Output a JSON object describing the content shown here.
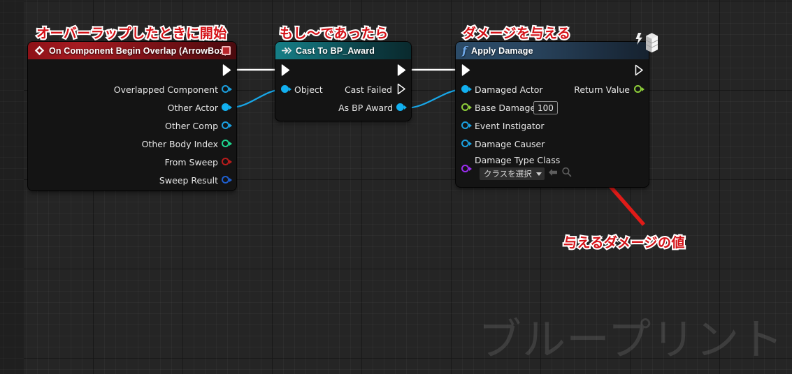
{
  "canvas": {
    "watermark": "ブループリント",
    "background_color": "#252525",
    "grid_minor_color": "#2d2d2d",
    "grid_major_color": "#111111"
  },
  "callouts": [
    {
      "id": "callout-begin-overlap",
      "text": "オーバーラップしたときに開始",
      "color": "#d41016"
    },
    {
      "id": "callout-cast",
      "text": "もし～であったら",
      "color": "#d41016"
    },
    {
      "id": "callout-apply-damage",
      "text": "ダメージを与える",
      "color": "#d41016"
    },
    {
      "id": "callout-damage-value",
      "text": "与えるダメージの値",
      "color": "#d41016"
    }
  ],
  "annotation_arrow": {
    "name": "red-pointer-arrow",
    "color": "#e01b18",
    "from": "与えるダメージの値",
    "points_to": "Base Damage"
  },
  "nodes": {
    "event": {
      "title": "On Component Begin Overlap (ArrowBox)",
      "header_color": "#a51b21",
      "icon": "event-diamond-icon",
      "badge": "red-square-icon",
      "exec_out": {
        "label": "",
        "type": "exec"
      },
      "outputs": [
        {
          "label": "Overlapped Component",
          "type": "object",
          "color": "#1ba0e0",
          "filled": false
        },
        {
          "label": "Other Actor",
          "type": "actor",
          "color": "#12b0f0",
          "filled": true
        },
        {
          "label": "Other Comp",
          "type": "object",
          "color": "#1ba0e0",
          "filled": false
        },
        {
          "label": "Other Body Index",
          "type": "integer",
          "color": "#1ed68f",
          "filled": false
        },
        {
          "label": "From Sweep",
          "type": "boolean",
          "color": "#b81c1c",
          "filled": false
        },
        {
          "label": "Sweep Result",
          "type": "struct",
          "color": "#1f5fd0",
          "filled": false
        }
      ]
    },
    "cast": {
      "title": "Cast To BP_Award",
      "header_color": "#12666e",
      "icon": "cast-arrow-icon",
      "inputs": [
        {
          "label": "Object",
          "type": "object",
          "color": "#12b0f0",
          "filled": true
        }
      ],
      "outputs": [
        {
          "label": "Cast Failed",
          "type": "exec"
        },
        {
          "label": "As BP Award",
          "type": "object",
          "color": "#12b0f0",
          "filled": true
        }
      ]
    },
    "apply_damage": {
      "title": "Apply Damage",
      "header_color": "#2a4660",
      "icon": "function-f-icon",
      "corner_icon": "server-stack-icon",
      "inputs": [
        {
          "label": "Damaged Actor",
          "type": "actor",
          "color": "#12b0f0",
          "filled": true
        },
        {
          "label": "Base Damage",
          "type": "float",
          "color": "#8ecf3a",
          "filled": false,
          "value": "100"
        },
        {
          "label": "Event Instigator",
          "type": "object",
          "color": "#1ba0e0",
          "filled": false
        },
        {
          "label": "Damage Causer",
          "type": "object",
          "color": "#1ba0e0",
          "filled": false
        },
        {
          "label": "Damage Type Class",
          "type": "class",
          "color": "#9b2df0",
          "filled": false,
          "select_label": "クラスを選択",
          "browse_icon": "back-arrow-icon",
          "search_icon": "magnifier-icon"
        }
      ],
      "outputs": [
        {
          "label": "Return Value",
          "type": "boolean-out",
          "color": "#8ecf3a",
          "filled": false
        }
      ]
    }
  },
  "wires": [
    {
      "name": "exec-event-to-cast",
      "color": "#ffffff",
      "type": "exec"
    },
    {
      "name": "data-other-actor-to-object",
      "color": "#18a7e8",
      "type": "data"
    },
    {
      "name": "exec-cast-to-apply",
      "color": "#ffffff",
      "type": "exec"
    },
    {
      "name": "data-asbpaward-to-damagedactor",
      "color": "#18a7e8",
      "type": "data"
    }
  ]
}
